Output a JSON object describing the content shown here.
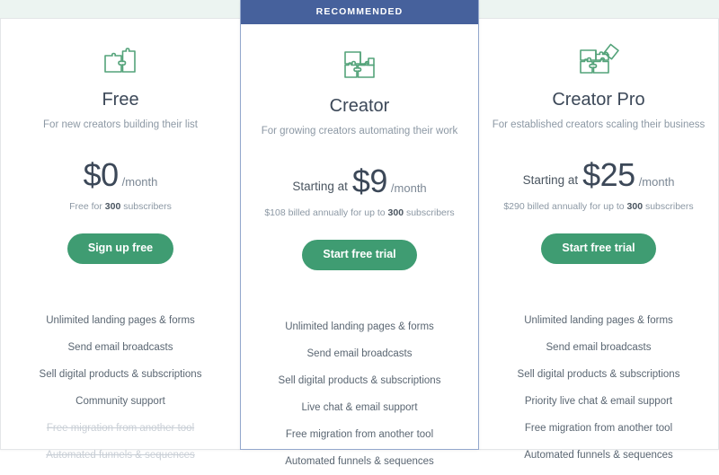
{
  "page": {
    "background_band_color": "#ecf4f1",
    "accent_green": "#3f9c72",
    "accent_blue": "#46619c"
  },
  "plans": [
    {
      "id": "free",
      "recommended": false,
      "badge_label": "",
      "icon_name": "puzzle-two-pieces-icon",
      "name": "Free",
      "tagline": "For new creators building their list",
      "price_prefix": "",
      "price_amount": "$0",
      "price_period": "/month",
      "price_note_before": "Free for ",
      "price_note_highlight": "300",
      "price_note_after": " subscribers",
      "cta_label": "Sign up free",
      "features": [
        {
          "label": "Unlimited landing pages & forms",
          "included": true
        },
        {
          "label": "Send email broadcasts",
          "included": true
        },
        {
          "label": "Sell digital products & subscriptions",
          "included": true
        },
        {
          "label": "Community support",
          "included": true
        },
        {
          "label": "Free migration from another tool",
          "included": false
        },
        {
          "label": "Automated funnels & sequences",
          "included": false
        }
      ]
    },
    {
      "id": "creator",
      "recommended": true,
      "badge_label": "RECOMMENDED",
      "icon_name": "puzzle-three-pieces-icon",
      "name": "Creator",
      "tagline": "For growing creators automating their work",
      "price_prefix": "Starting at",
      "price_amount": "$9",
      "price_period": "/month",
      "price_note_before": "$108 billed annually for up to ",
      "price_note_highlight": "300",
      "price_note_after": " subscribers",
      "cta_label": "Start free trial",
      "features": [
        {
          "label": "Unlimited landing pages & forms",
          "included": true
        },
        {
          "label": "Send email broadcasts",
          "included": true
        },
        {
          "label": "Sell digital products & subscriptions",
          "included": true
        },
        {
          "label": "Live chat & email support",
          "included": true
        },
        {
          "label": "Free migration from another tool",
          "included": true
        },
        {
          "label": "Automated funnels & sequences",
          "included": true
        }
      ]
    },
    {
      "id": "creator-pro",
      "recommended": false,
      "badge_label": "",
      "icon_name": "puzzle-four-pieces-icon",
      "name": "Creator Pro",
      "tagline": "For established creators scaling their business",
      "price_prefix": "Starting at",
      "price_amount": "$25",
      "price_period": "/month",
      "price_note_before": "$290 billed annually for up to ",
      "price_note_highlight": "300",
      "price_note_after": " subscribers",
      "cta_label": "Start free trial",
      "features": [
        {
          "label": "Unlimited landing pages & forms",
          "included": true
        },
        {
          "label": "Send email broadcasts",
          "included": true
        },
        {
          "label": "Sell digital products & subscriptions",
          "included": true
        },
        {
          "label": "Priority live chat & email support",
          "included": true
        },
        {
          "label": "Free migration from another tool",
          "included": true
        },
        {
          "label": "Automated funnels & sequences",
          "included": true
        }
      ]
    }
  ]
}
